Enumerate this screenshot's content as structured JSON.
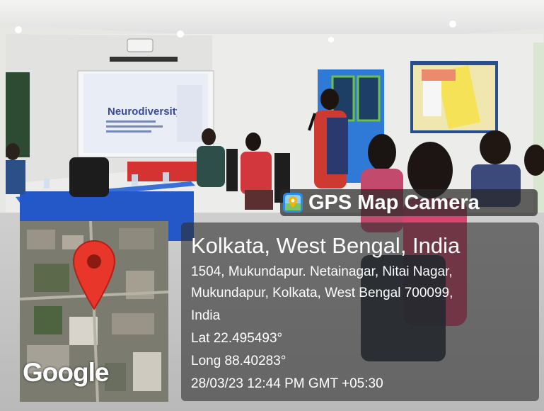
{
  "overlay": {
    "app_name": "GPS Map Camera",
    "location_title": "Kolkata, West Bengal, India",
    "address_lines": [
      "1504, Mukundapur. Netainagar, Nitai Nagar,",
      "Mukundapur, Kolkata, West Bengal 700099,",
      "India"
    ],
    "latitude": "Lat 22.495493°",
    "longitude": "Long 88.40283°",
    "timestamp": "28/03/23 12:44 PM GMT +05:30",
    "map_logo": "Google"
  },
  "scene": {
    "projected_slide_title": "Neurodiversity:"
  },
  "colors": {
    "overlay_bg": "#2d2d2d",
    "map_pin": "#e8362b",
    "app_icon": "#2b8be8",
    "wall": "#e9e9e6",
    "table": "#2458c9"
  },
  "icons": [
    "app-icon",
    "map-pin-icon"
  ]
}
